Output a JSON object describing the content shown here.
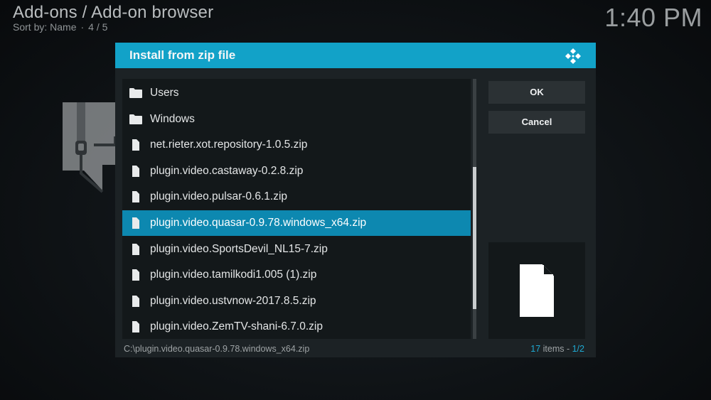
{
  "header": {
    "title": "Add-ons / Add-on browser",
    "sort_label": "Sort by: Name",
    "separator": "·",
    "position": "4 / 5",
    "clock": "1:40 PM"
  },
  "dialog": {
    "title": "Install from zip file",
    "ok_label": "OK",
    "cancel_label": "Cancel",
    "items": [
      {
        "label": "Users",
        "type": "folder"
      },
      {
        "label": "Windows",
        "type": "folder"
      },
      {
        "label": "net.rieter.xot.repository-1.0.5.zip",
        "type": "file"
      },
      {
        "label": "plugin.video.castaway-0.2.8.zip",
        "type": "file"
      },
      {
        "label": "plugin.video.pulsar-0.6.1.zip",
        "type": "file"
      },
      {
        "label": "plugin.video.quasar-0.9.78.windows_x64.zip",
        "type": "file",
        "selected": true
      },
      {
        "label": "plugin.video.SportsDevil_NL15-7.zip",
        "type": "file"
      },
      {
        "label": "plugin.video.tamilkodi1.005 (1).zip",
        "type": "file"
      },
      {
        "label": "plugin.video.ustvnow-2017.8.5.zip",
        "type": "file"
      },
      {
        "label": "plugin.video.ZemTV-shani-6.7.0.zip",
        "type": "file"
      }
    ],
    "footer": {
      "path": "C:\\plugin.video.quasar-0.9.78.windows_x64.zip",
      "count": "17",
      "items_word": " items - ",
      "page": "1/2"
    }
  },
  "colors": {
    "accent": "#12a2c8",
    "selected_row": "#0d88b0",
    "highlight_text": "#1ea9d2"
  },
  "icons": {
    "folder": "folder-icon",
    "file": "file-icon",
    "logo": "kodi-logo-icon",
    "background": "zip-archive-icon"
  }
}
